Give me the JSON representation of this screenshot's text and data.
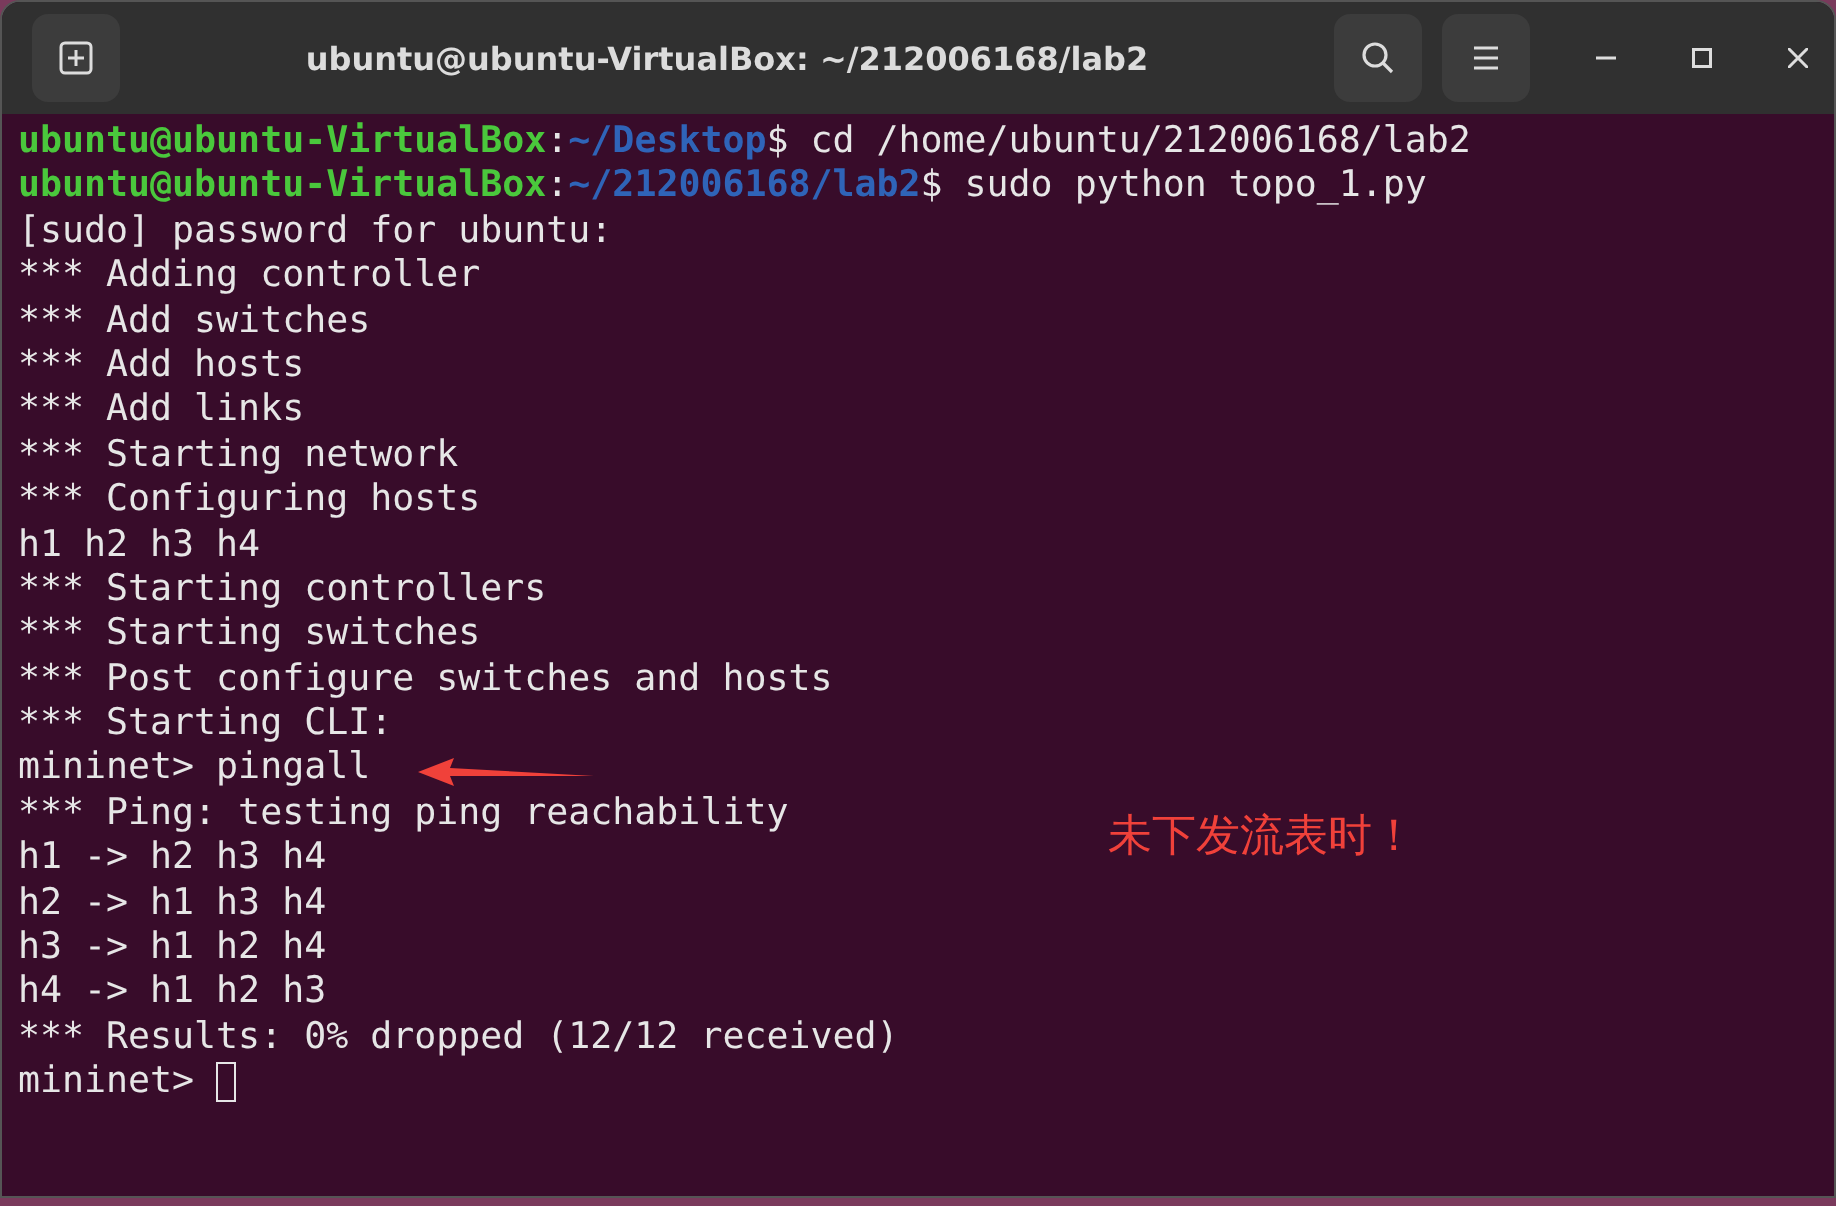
{
  "window": {
    "title": "ubuntu@ubuntu-VirtualBox: ~/212006168/lab2"
  },
  "lines": [
    {
      "kind": "prompt",
      "user": "ubuntu@ubuntu-VirtualBox",
      "sep": ":",
      "path": "~/Desktop",
      "command": "$ cd /home/ubuntu/212006168/lab2"
    },
    {
      "kind": "prompt",
      "user": "ubuntu@ubuntu-VirtualBox",
      "sep": ":",
      "path": "~/212006168/lab2",
      "command": "$ sudo python topo_1.py"
    },
    {
      "kind": "output",
      "text": "[sudo] password for ubuntu:"
    },
    {
      "kind": "output",
      "text": "*** Adding controller"
    },
    {
      "kind": "output",
      "text": "*** Add switches"
    },
    {
      "kind": "output",
      "text": "*** Add hosts"
    },
    {
      "kind": "output",
      "text": "*** Add links"
    },
    {
      "kind": "output",
      "text": "*** Starting network"
    },
    {
      "kind": "output",
      "text": "*** Configuring hosts"
    },
    {
      "kind": "output",
      "text": "h1 h2 h3 h4"
    },
    {
      "kind": "output",
      "text": "*** Starting controllers"
    },
    {
      "kind": "output",
      "text": "*** Starting switches"
    },
    {
      "kind": "output",
      "text": "*** Post configure switches and hosts"
    },
    {
      "kind": "output",
      "text": "*** Starting CLI:"
    },
    {
      "kind": "output",
      "text": "mininet> pingall"
    },
    {
      "kind": "output",
      "text": "*** Ping: testing ping reachability"
    },
    {
      "kind": "output",
      "text": "h1 -> h2 h3 h4"
    },
    {
      "kind": "output",
      "text": "h2 -> h1 h3 h4"
    },
    {
      "kind": "output",
      "text": "h3 -> h1 h2 h4"
    },
    {
      "kind": "output",
      "text": "h4 -> h1 h2 h3"
    },
    {
      "kind": "output",
      "text": "*** Results: 0% dropped (12/12 received)"
    },
    {
      "kind": "input",
      "text": "mininet>",
      "cursor": true
    }
  ],
  "annotation": {
    "text": "未下发流表时！"
  }
}
